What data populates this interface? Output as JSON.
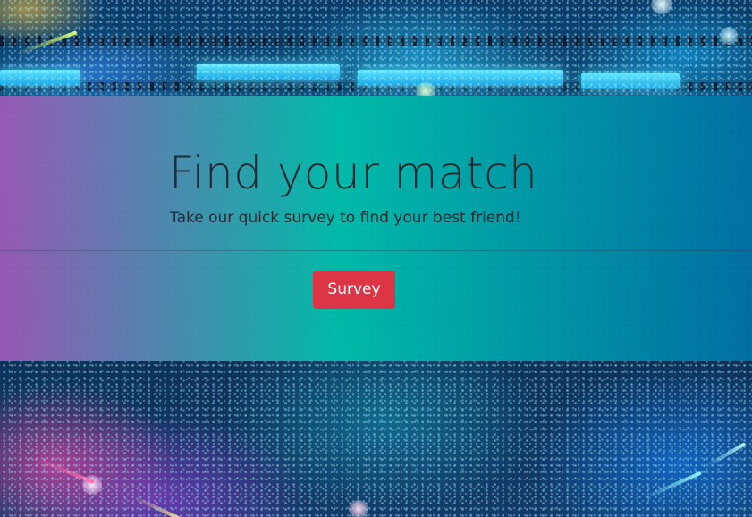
{
  "hero": {
    "title": "Find your match",
    "subtitle": "Take our quick survey to find your best friend!",
    "survey_button_label": "Survey"
  },
  "colors": {
    "band_gradient_start": "#9b59b6",
    "band_gradient_mid": "#00beaa",
    "band_gradient_end": "#0070a4",
    "button": "#dc3545",
    "text": "#232a32"
  }
}
